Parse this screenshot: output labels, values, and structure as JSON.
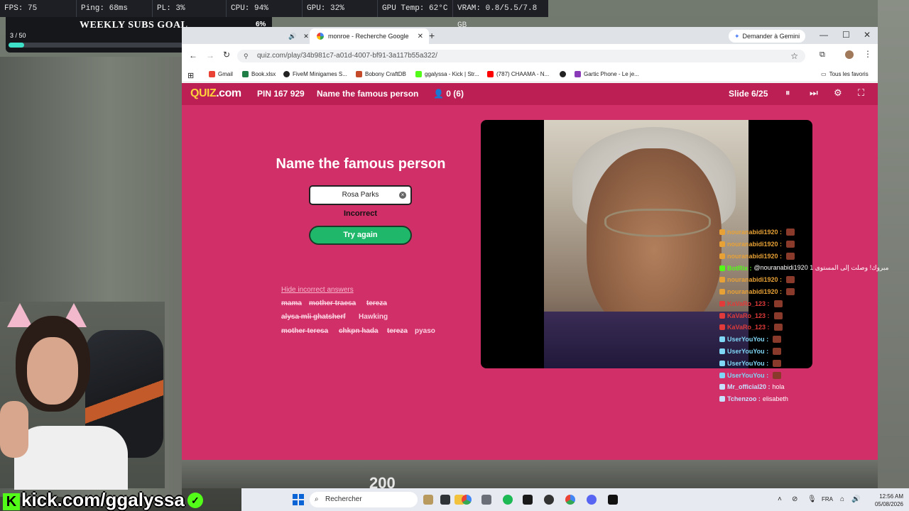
{
  "stats": {
    "fps": "FPS: 75",
    "ping": "Ping: 68ms",
    "pl": "PL: 3%",
    "cpu": "CPU: 94%",
    "gpu": "GPU: 32%",
    "gpu_temp": "GPU Temp: 62°C",
    "vram": "VRAM: 0.8/5.5/7.8 GB"
  },
  "subs_goal": {
    "title": "WEEKLY SUBS GOAL",
    "percent": "6%",
    "count": "3 / 50",
    "progress_fraction": 0.06
  },
  "browser": {
    "tab_title": "monroe - Recherche Google",
    "gemini_label": "Demander à Gemini",
    "url": "quiz.com/play/34b981c7-a01d-4007-bf91-3a117b55a322/",
    "bookmarks": [
      {
        "label": "Gmail",
        "color": "#ea4335"
      },
      {
        "label": "Book.xlsx",
        "color": "#1e7e45"
      },
      {
        "label": "FiveM Minigames S...",
        "color": "#222222"
      },
      {
        "label": "Bobony CraftDB",
        "color": "#c44a2a"
      },
      {
        "label": "ggalyssa - Kick | Str...",
        "color": "#53fc18"
      },
      {
        "label": "(787) CHAAMA - N...",
        "color": "#ff0000"
      },
      {
        "label": "",
        "color": "#222222"
      },
      {
        "label": "Gartic Phone - Le je...",
        "color": "#8a3ab9"
      }
    ],
    "all_bookmarks": "Tous les favoris"
  },
  "quiz": {
    "logo_main": "QUIZ",
    "logo_suffix": ".com",
    "pin": "PIN 167 929",
    "title": "Name the famous person",
    "players": "0 (6)",
    "slide": "Slide 6/25",
    "question": "Name the famous person",
    "answer_value": "Rosa Parks",
    "status": "Incorrect",
    "try_again": "Try again",
    "hide_link": "Hide incorrect answers",
    "incorrect_answers": [
      "mama",
      "mother traesa",
      "tereza",
      "alysa mli ghatsherf",
      "Hawking",
      "mother teresa",
      "chkpn hada",
      "tereza",
      "pyaso"
    ]
  },
  "chat": [
    {
      "user": "nouranabidi1920 :",
      "msg": "",
      "color": "#e8a135",
      "emote": true
    },
    {
      "user": "nouranabidi1920 :",
      "msg": "",
      "color": "#e8a135",
      "emote": true
    },
    {
      "user": "nouranabidi1920 :",
      "msg": "",
      "color": "#e8a135",
      "emote": true
    },
    {
      "user": "BotRix :",
      "msg": "@nouranabidi1920 مبروك! وصلت إلى المستوى 1",
      "color": "#53fc18",
      "emote": false
    },
    {
      "user": "nouranabidi1920 :",
      "msg": "",
      "color": "#e8a135",
      "emote": true
    },
    {
      "user": "nouranabidi1920 :",
      "msg": "",
      "color": "#e8a135",
      "emote": true
    },
    {
      "user": "KaVaRo_123 :",
      "msg": "",
      "color": "#e03a3a",
      "emote": true
    },
    {
      "user": "KaVaRo_123 :",
      "msg": "",
      "color": "#e03a3a",
      "emote": true
    },
    {
      "user": "KaVaRo_123 :",
      "msg": "",
      "color": "#e03a3a",
      "emote": true
    },
    {
      "user": "UserYouYou :",
      "msg": "",
      "color": "#7fd6f5",
      "emote": true
    },
    {
      "user": "UserYouYou :",
      "msg": "",
      "color": "#7fd6f5",
      "emote": true
    },
    {
      "user": "UserYouYou :",
      "msg": "",
      "color": "#7fd6f5",
      "emote": true
    },
    {
      "user": "UserYouYou :",
      "msg": "",
      "color": "#7fd6f5",
      "emote": true
    },
    {
      "user": "Mr_official20 :",
      "msg": "hola",
      "color": "#c8e0ff",
      "emote": false
    },
    {
      "user": "Tchenzoo :",
      "msg": "elisabeth",
      "color": "#c8e0ff",
      "emote": false
    }
  ],
  "kick": {
    "logo_letter": "K",
    "text": "kick.com/ggalyssa",
    "check": "✓"
  },
  "taskbar": {
    "search_placeholder": "Rechercher",
    "lang": "FRA",
    "time": "12:56 AM",
    "date": "05/08/2026"
  },
  "hud": {
    "value": "200"
  },
  "icons": {
    "close": "✕",
    "back": "←",
    "forward": "→",
    "reload": "↻",
    "star": "☆",
    "pause": "⏸",
    "skip": "⏭",
    "gear": "⚙",
    "fullscreen": "⛶"
  }
}
